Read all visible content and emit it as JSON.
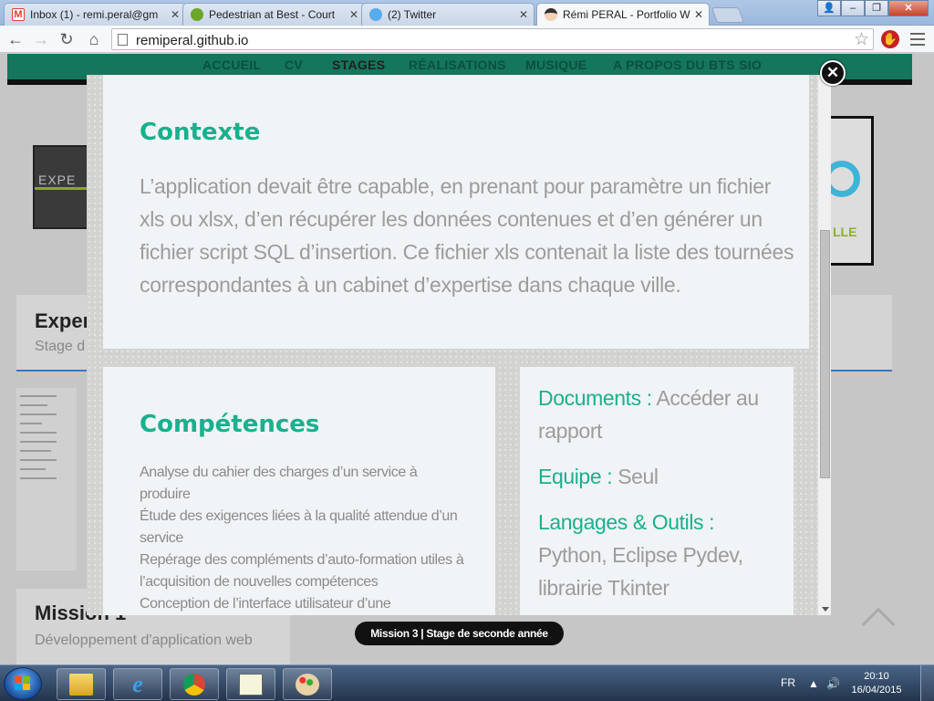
{
  "browser": {
    "tabs": [
      {
        "title": "Inbox (1) - remi.peral@gm",
        "favicon": "gmail-icon",
        "color": "#d44638"
      },
      {
        "title": "Pedestrian at Best - Court",
        "favicon": "spotify-icon",
        "color": "#6aa629"
      },
      {
        "title": "(2) Twitter",
        "favicon": "twitter-icon",
        "color": "#55acee"
      },
      {
        "title": "Rémi PERAL - Portfolio W",
        "favicon": "avatar-icon",
        "color": "#444444",
        "active": true
      }
    ],
    "url": "remiperal.github.io"
  },
  "site": {
    "nav": [
      "ACCUEIL",
      "CV",
      "STAGES",
      "RÉALISATIONS",
      "MUSIQUE",
      "A PROPOS DU BTS SIO"
    ],
    "bg_logo_text": "EXPE",
    "bg_right_text": "LLE",
    "card1": {
      "title": "Exper",
      "subtitle": "Stage d"
    },
    "card2": {
      "title": "Mission 1",
      "subtitle": "Développement d'application web"
    }
  },
  "modal": {
    "context": {
      "heading": "Contexte",
      "text": "L’application devait être capable, en prenant pour paramètre un fichier xls ou xlsx, d’en récupérer les données contenues et d’en générer un fichier script SQL d’insertion. Ce fichier xls contenait la liste des tournées correspondantes à un cabinet d’expertise dans chaque ville."
    },
    "competences": {
      "heading": "Compétences",
      "items": [
        "Analyse du cahier des charges d’un service à produire",
        "Étude des exigences liées à la qualité attendue d’un service",
        "Repérage des compléments d’auto-formation utiles à l’acquisition de nouvelles compétences",
        "Conception de l’interface utilisateur d’une"
      ]
    },
    "details": {
      "documents_label": "Documents :",
      "documents_value": "Accéder au rapport",
      "equipe_label": "Equipe :",
      "equipe_value": "Seul",
      "langages_label": "Langages & Outils :",
      "langages_value": "Python, Eclipse Pydev, librairie Tkinter"
    },
    "close_glyph": "✕"
  },
  "caption": "Mission 3 | Stage de seconde année",
  "taskbar": {
    "lang": "FR",
    "time": "20:10",
    "date": "16/04/2015"
  }
}
